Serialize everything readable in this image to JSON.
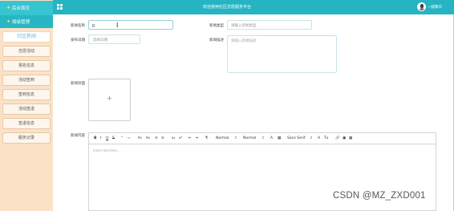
{
  "header": {
    "title": "欢迎使用社区志愿服务平台",
    "user_name": "一醉繁华",
    "menu_icon": "grid-icon",
    "avatar_icon": "avatar"
  },
  "sidebar": {
    "sections": [
      {
        "label": "后台首页",
        "icon": "star-icon"
      },
      {
        "label": "赣级管理",
        "icon": "star-icon"
      }
    ],
    "items": [
      {
        "label": "社区新闻",
        "active": true
      },
      {
        "label": "志愿活动",
        "active": false
      },
      {
        "label": "报名信息",
        "active": false
      },
      {
        "label": "活动签到",
        "active": false
      },
      {
        "label": "签到信息",
        "active": false
      },
      {
        "label": "活动签退",
        "active": false
      },
      {
        "label": "签退信息",
        "active": false
      },
      {
        "label": "服务记录",
        "active": false
      }
    ]
  },
  "form": {
    "title_label": "新闻名称",
    "title_value": "g",
    "type_label": "新闻类型",
    "type_placeholder": "请输入新闻类型",
    "date_label": "发布日期",
    "date_placeholder": "选择日期",
    "desc_label": "新闻描述",
    "desc_placeholder": "请输入新闻描述",
    "cover_label": "新闻封面",
    "content_label": "新闻内容"
  },
  "editor": {
    "placeholder": "Insert text here ...",
    "toolbar": [
      "B",
      "I",
      "U",
      "S",
      "“",
      "‹›",
      "H₁",
      "H₂",
      "≡",
      "≡",
      "x₂",
      "x²",
      "⇤",
      "⇥",
      "¶",
      "Normal",
      "⇕",
      "Normal",
      "⇕",
      "A",
      "▦",
      "Sans Serif",
      "⇕",
      "A",
      "▤",
      "Tx",
      "🔗",
      "▣",
      "▦"
    ]
  },
  "watermark": "CSDN @MZ_ZXD001",
  "colors": {
    "topbar": "#26b3c2",
    "sidebar": "#fbe2c7",
    "accent": "#8fd2db"
  }
}
